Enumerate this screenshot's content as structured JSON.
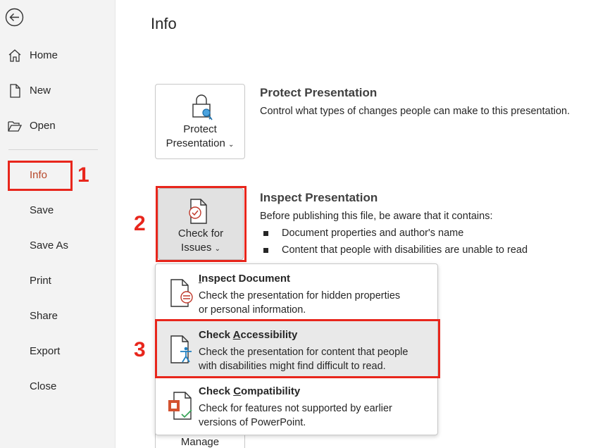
{
  "sidebar": {
    "items": [
      {
        "label": "Home",
        "icon": "home-icon"
      },
      {
        "label": "New",
        "icon": "new-document-icon"
      },
      {
        "label": "Open",
        "icon": "folder-open-icon"
      },
      {
        "label": "Info"
      },
      {
        "label": "Save"
      },
      {
        "label": "Save As"
      },
      {
        "label": "Print"
      },
      {
        "label": "Share"
      },
      {
        "label": "Export"
      },
      {
        "label": "Close"
      }
    ],
    "active": "Info"
  },
  "main": {
    "title": "Info",
    "protect": {
      "tile_line1": "Protect",
      "tile_line2": "Presentation",
      "heading": "Protect Presentation",
      "description": "Control what types of changes people can make to this presentation."
    },
    "inspect": {
      "tile_line1": "Check for",
      "tile_line2": "Issues",
      "heading": "Inspect Presentation",
      "description": "Before publishing this file, be aware that it contains:",
      "bullets": [
        "Document properties and author's name",
        "Content that people with disabilities are unable to read"
      ]
    },
    "menu": {
      "items": [
        {
          "title_pre": "",
          "title_ul": "I",
          "title_post": "nspect Document",
          "desc_line1": "Check the presentation for hidden properties",
          "desc_line2": "or personal information."
        },
        {
          "title_pre": "Check ",
          "title_ul": "A",
          "title_post": "ccessibility",
          "desc_line1": "Check the presentation for content that people",
          "desc_line2": "with disabilities might find difficult to read."
        },
        {
          "title_pre": "Check ",
          "title_ul": "C",
          "title_post": "ompatibility",
          "desc_line1": "Check for features not supported by earlier",
          "desc_line2": "versions of PowerPoint."
        }
      ]
    },
    "manage_label": "Manage"
  },
  "annotations": [
    "1",
    "2",
    "3"
  ],
  "colors": {
    "annotation": "#e8261c",
    "active_nav": "#b7472a",
    "hover": "#e9e9e9"
  }
}
